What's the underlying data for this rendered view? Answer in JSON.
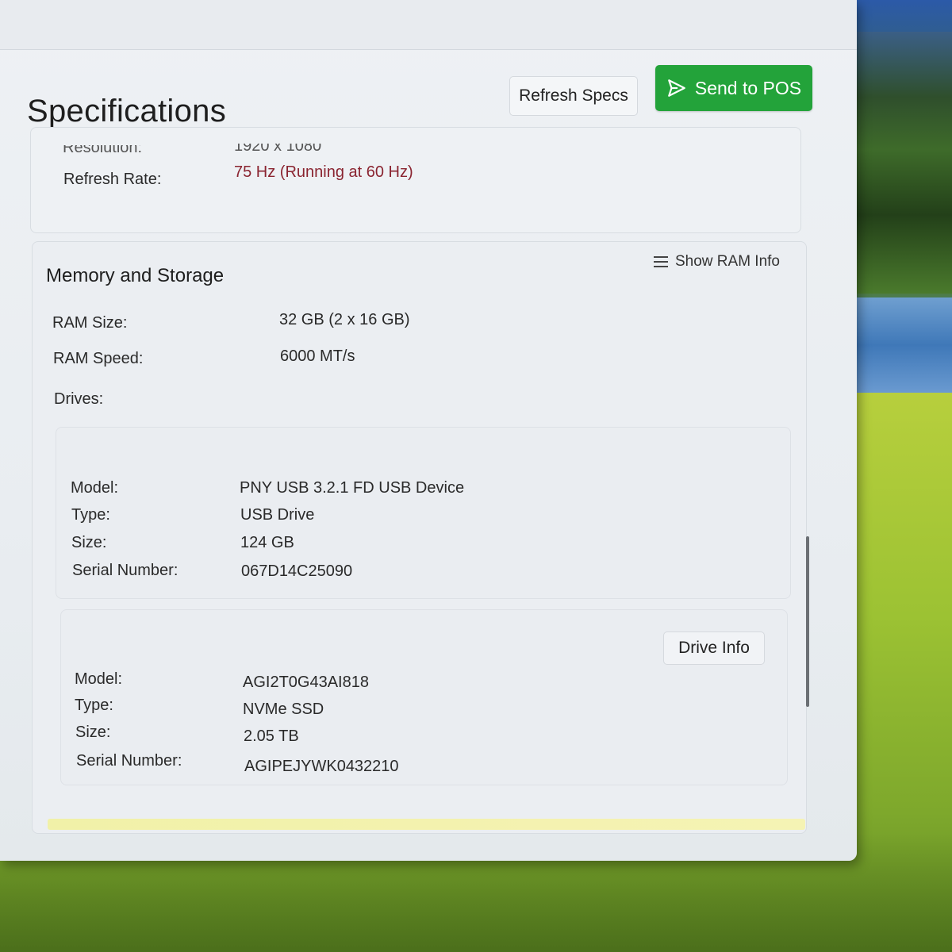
{
  "page": {
    "title": "Specifications",
    "buttons": {
      "refresh_label": "Refresh Specs",
      "send_label": "Send to POS"
    },
    "accent_color": "#23a33a",
    "warning_color": "#8a2430"
  },
  "display": {
    "resolution_label": "Resolution:",
    "resolution_value": "1920 x 1080",
    "refresh_rate_label": "Refresh Rate:",
    "refresh_rate_value": "75 Hz (Running at 60 Hz)"
  },
  "memory": {
    "title": "Memory and Storage",
    "show_ram_label": "Show RAM Info",
    "ram_size_label": "RAM Size:",
    "ram_size_value": "32 GB (2 x 16 GB)",
    "ram_speed_label": "RAM Speed:",
    "ram_speed_value": "6000 MT/s",
    "drives_label": "Drives:"
  },
  "drives": [
    {
      "model_label": "Model:",
      "model": "PNY USB 3.2.1 FD USB Device",
      "type_label": "Type:",
      "type": "USB Drive",
      "size_label": "Size:",
      "size": "124 GB",
      "serial_label": "Serial Number:",
      "serial": "067D14C25090"
    },
    {
      "info_button_label": "Drive Info",
      "model_label": "Model:",
      "model": "AGI2T0G43AI818",
      "type_label": "Type:",
      "type": "NVMe SSD",
      "size_label": "Size:",
      "size": "2.05 TB",
      "serial_label": "Serial Number:",
      "serial": "AGIPEJYWK0432210"
    }
  ]
}
